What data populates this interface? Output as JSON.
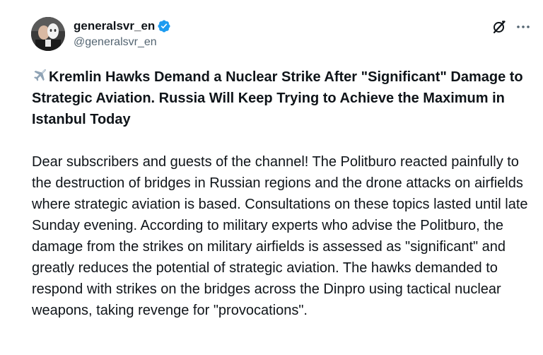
{
  "author": {
    "display_name": "generalsvr_en",
    "handle": "@generalsvr_en",
    "verified": true,
    "verified_color": "#1d9bf0",
    "avatar_icon": "avatar-image"
  },
  "actions": {
    "grok_icon": "grok-icon",
    "more_icon": "more-options-icon"
  },
  "post": {
    "title_emoji": "airplane-emoji",
    "title": "Kremlin Hawks Demand a Nuclear Strike After \"Significant\" Damage to Strategic Aviation. Russia Will Keep Trying to Achieve the Maximum in Istanbul Today",
    "body": "Dear subscribers and guests of the channel! The Politburo reacted painfully to the destruction of bridges in Russian regions and the drone attacks on airfields where strategic aviation is based. Consultations on these topics lasted until late Sunday evening. According to military experts who advise the Politburo, the damage from the strikes on military airfields is assessed as \"significant\" and greatly reduces the potential of strategic aviation. The hawks demanded to respond with strikes on the bridges across the Dinpro using tactical nuclear weapons, taking revenge for \"provocations\"."
  },
  "colors": {
    "text": "#0f1419",
    "secondary": "#536471",
    "accent": "#1d9bf0"
  }
}
